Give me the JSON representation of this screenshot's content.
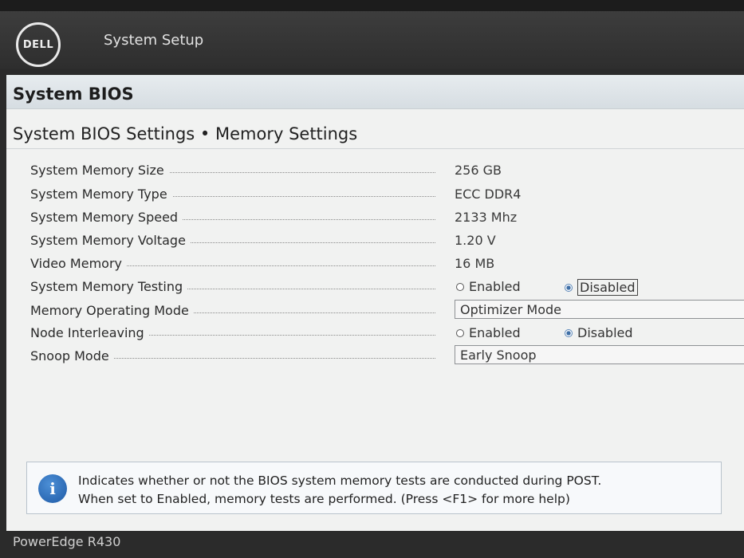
{
  "header": {
    "logo_text": "DELL",
    "app_title": "System Setup"
  },
  "section": {
    "title": "System BIOS"
  },
  "page": {
    "subtitle": "System BIOS Settings • Memory Settings"
  },
  "rows": [
    {
      "label": "System Memory Size",
      "value": "256 GB"
    },
    {
      "label": "System Memory Type",
      "value": "ECC DDR4"
    },
    {
      "label": "System Memory Speed",
      "value": "2133 Mhz"
    },
    {
      "label": "System Memory Voltage",
      "value": "1.20 V"
    },
    {
      "label": "Video Memory",
      "value": "16 MB"
    },
    {
      "label": "System Memory Testing",
      "options": [
        "Enabled",
        "Disabled"
      ],
      "selected": "Disabled"
    },
    {
      "label": "Memory Operating Mode",
      "value": "Optimizer Mode"
    },
    {
      "label": "Node Interleaving",
      "options": [
        "Enabled",
        "Disabled"
      ],
      "selected": "Disabled"
    },
    {
      "label": "Snoop Mode",
      "value": "Early Snoop"
    }
  ],
  "help": {
    "icon": "info-icon",
    "line1": "Indicates whether or not the BIOS system memory tests are conducted during POST.",
    "line2": "When set to Enabled, memory tests are performed. (Press <F1> for more help)"
  },
  "footer": {
    "model": "PowerEdge R430"
  },
  "colors": {
    "header_bg": "#333333",
    "panel_bg": "#f1f2f1",
    "accent": "#1e5aa6"
  }
}
